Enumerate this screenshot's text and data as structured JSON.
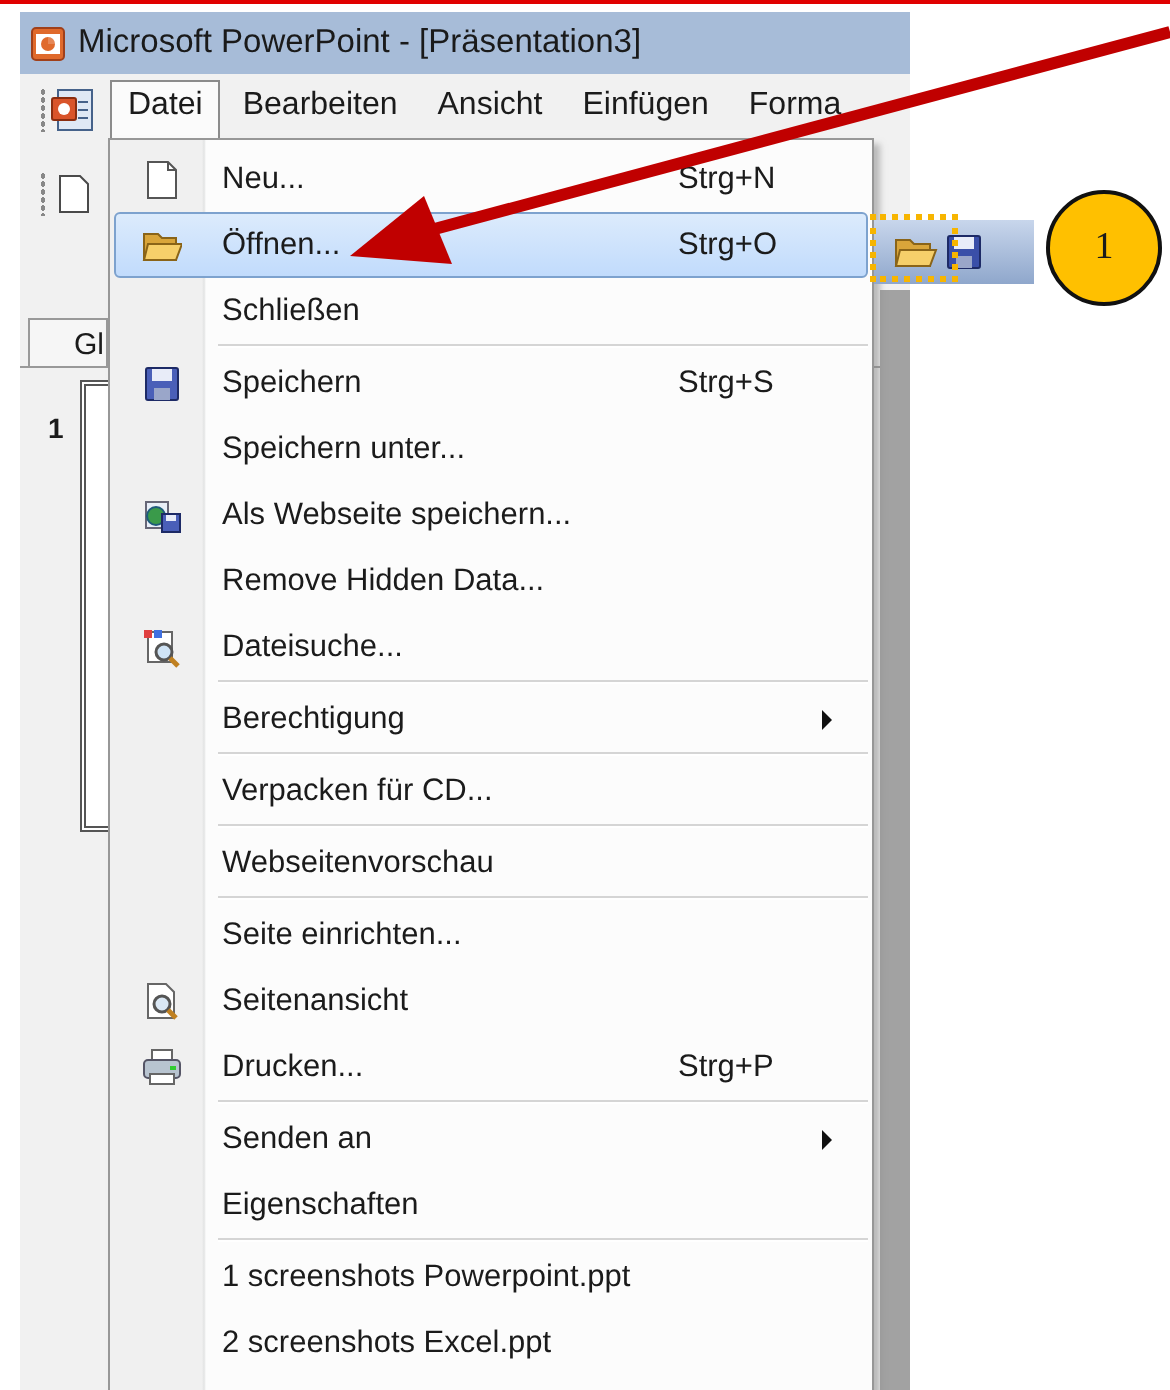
{
  "window": {
    "title": "Microsoft PowerPoint - [Präsentation3]"
  },
  "menu_bar": [
    {
      "label": "Datei",
      "selected": true
    },
    {
      "label": "Bearbeiten",
      "selected": false
    },
    {
      "label": "Ansicht",
      "selected": false
    },
    {
      "label": "Einfügen",
      "selected": false
    },
    {
      "label": "Forma",
      "selected": false
    }
  ],
  "file_menu": [
    {
      "kind": "item",
      "label": "Neu...",
      "shortcut": "Strg+N",
      "selected": false,
      "submenu": false
    },
    {
      "kind": "item",
      "label": "Öffnen...",
      "shortcut": "Strg+O",
      "selected": true,
      "submenu": false
    },
    {
      "kind": "item",
      "label": "Schließen",
      "selected": false,
      "submenu": false
    },
    {
      "kind": "separator"
    },
    {
      "kind": "item",
      "label": "Speichern",
      "shortcut": "Strg+S",
      "selected": false,
      "submenu": false
    },
    {
      "kind": "item",
      "label": "Speichern unter...",
      "selected": false,
      "submenu": false
    },
    {
      "kind": "item",
      "label": "Als Webseite speichern...",
      "selected": false,
      "submenu": false
    },
    {
      "kind": "item",
      "label": "Remove Hidden Data...",
      "selected": false,
      "submenu": false
    },
    {
      "kind": "item",
      "label": "Dateisuche...",
      "selected": false,
      "submenu": false
    },
    {
      "kind": "separator"
    },
    {
      "kind": "item",
      "label": "Berechtigung",
      "selected": false,
      "submenu": true
    },
    {
      "kind": "separator"
    },
    {
      "kind": "item",
      "label": "Verpacken für CD...",
      "selected": false,
      "submenu": false
    },
    {
      "kind": "separator"
    },
    {
      "kind": "item",
      "label": "Webseitenvorschau",
      "selected": false,
      "submenu": false
    },
    {
      "kind": "separator"
    },
    {
      "kind": "item",
      "label": "Seite einrichten...",
      "selected": false,
      "submenu": false
    },
    {
      "kind": "item",
      "label": "Seitenansicht",
      "selected": false,
      "submenu": false
    },
    {
      "kind": "item",
      "label": "Drucken...",
      "shortcut": "Strg+P",
      "selected": false,
      "submenu": false
    },
    {
      "kind": "separator"
    },
    {
      "kind": "item",
      "label": "Senden an",
      "selected": false,
      "submenu": true
    },
    {
      "kind": "item",
      "label": "Eigenschaften",
      "selected": false,
      "submenu": false
    },
    {
      "kind": "separator"
    },
    {
      "kind": "item",
      "label": "1 screenshots Powerpoint.ppt",
      "selected": false,
      "submenu": false
    },
    {
      "kind": "item",
      "label": "2 screenshots Excel.ppt",
      "selected": false,
      "submenu": false
    }
  ],
  "slide_pane": {
    "tab": "Gl",
    "slide_number": "1"
  },
  "callout": "1"
}
